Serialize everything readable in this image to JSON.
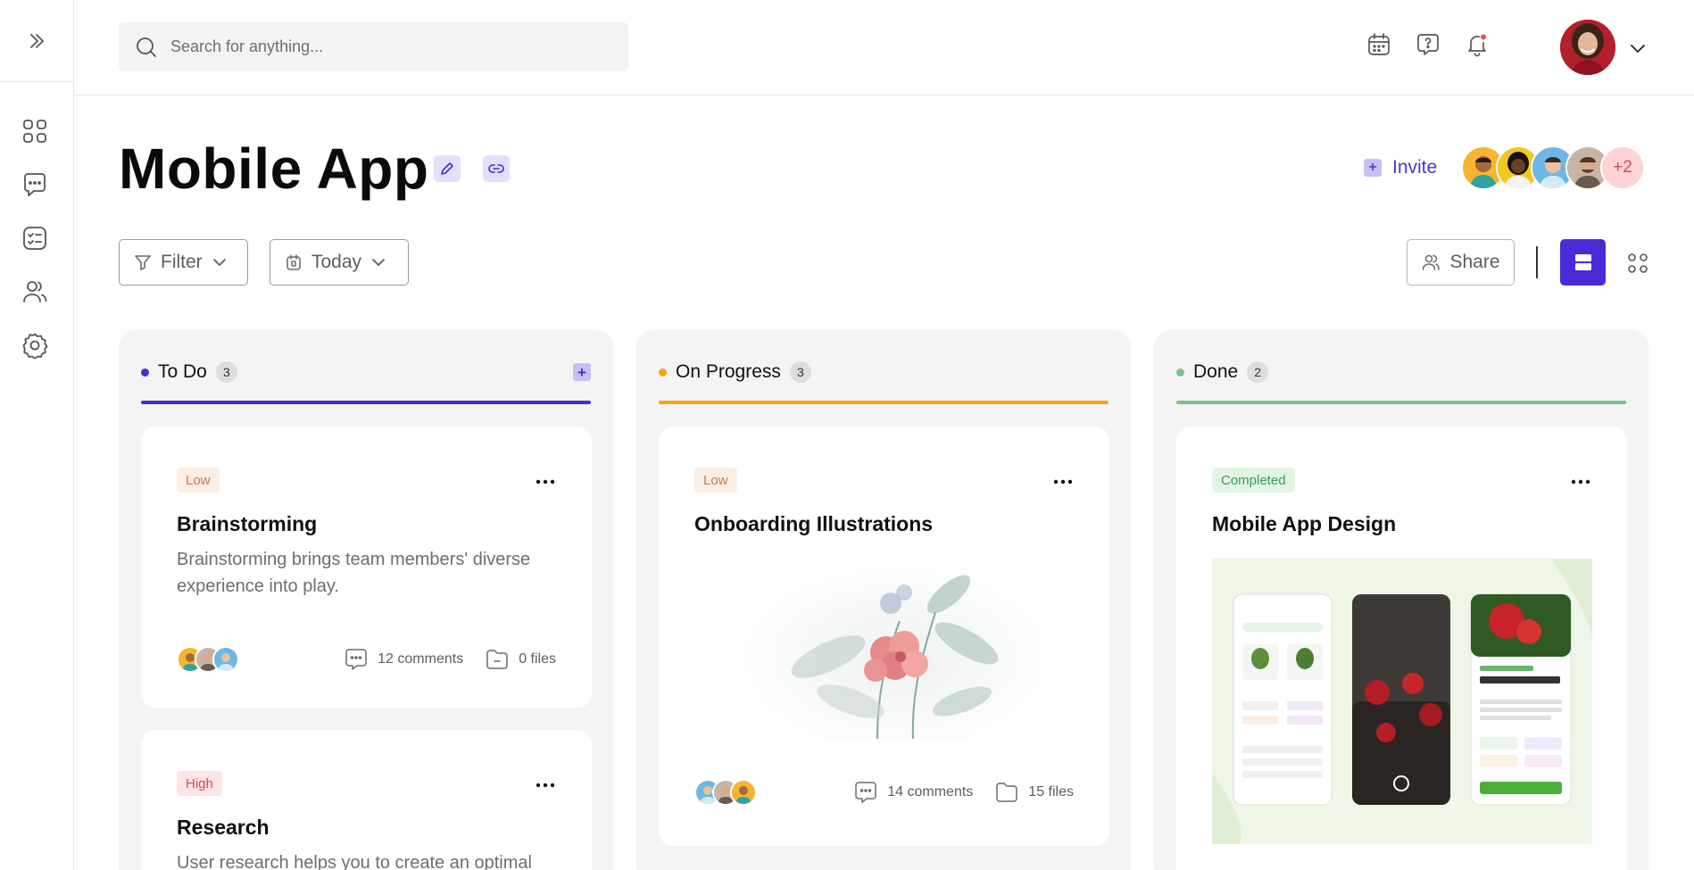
{
  "search": {
    "placeholder": "Search for anything..."
  },
  "header": {
    "title": "Mobile App",
    "invite_label": "Invite",
    "extra_members": "+2"
  },
  "toolbar": {
    "filter_label": "Filter",
    "date_label": "Today",
    "share_label": "Share"
  },
  "sidebar": {
    "items": [
      {
        "icon": "dashboard-icon"
      },
      {
        "icon": "chat-icon"
      },
      {
        "icon": "tasks-icon"
      },
      {
        "icon": "team-icon"
      },
      {
        "icon": "settings-icon"
      }
    ]
  },
  "colors": {
    "accent": "#4b2ad8",
    "todo": "#4b2ad8",
    "progress": "#f5a316",
    "done": "#7cc08a"
  },
  "columns": [
    {
      "title": "To Do",
      "count": "3",
      "cards": [
        {
          "tag": "Low",
          "title": "Brainstorming",
          "description": "Brainstorming brings team members' diverse experience into play.",
          "comments": "12 comments",
          "files": "0 files"
        },
        {
          "tag": "High",
          "title": "Research",
          "description": "User research helps you to create an optimal"
        }
      ]
    },
    {
      "title": "On Progress",
      "count": "3",
      "cards": [
        {
          "tag": "Low",
          "title": "Onboarding Illustrations",
          "comments": "14 comments",
          "files": "15 files"
        }
      ]
    },
    {
      "title": "Done",
      "count": "2",
      "cards": [
        {
          "tag": "Completed",
          "title": "Mobile App Design"
        }
      ]
    }
  ]
}
